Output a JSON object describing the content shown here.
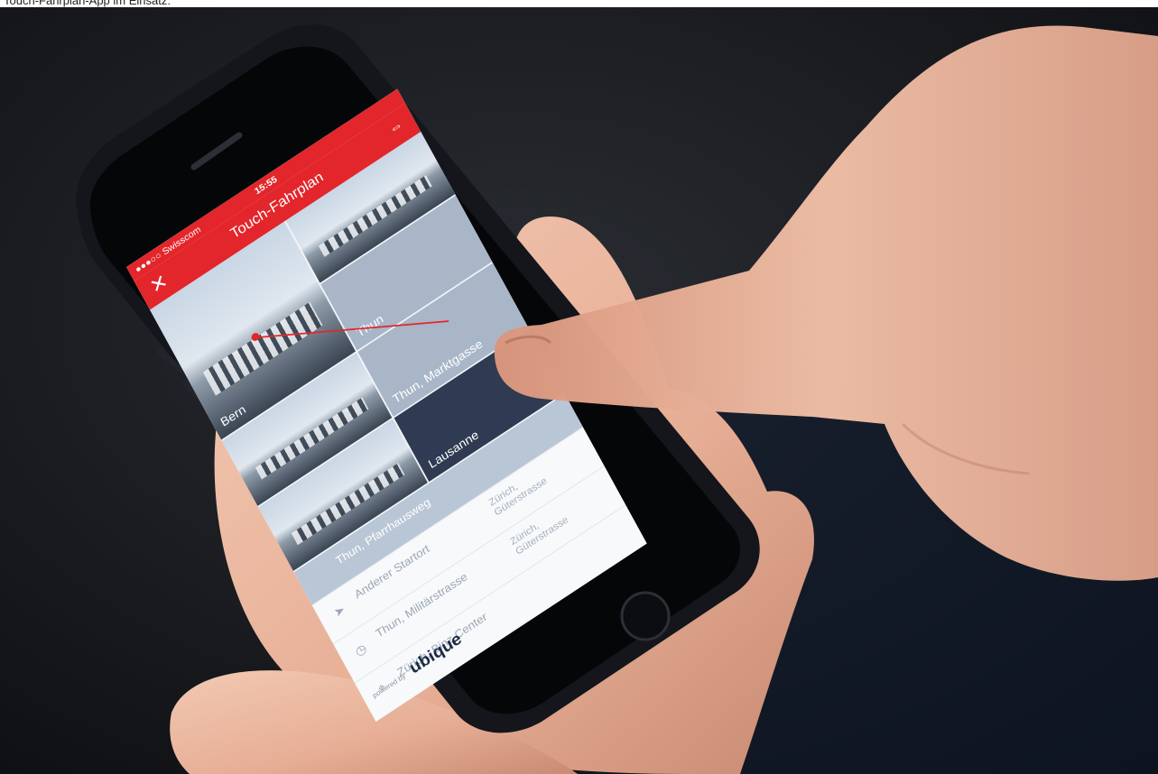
{
  "caption": "Touch-Fahrplan-App im Einsatz:",
  "app": {
    "carrier": "●●●○○ Swisscom",
    "time": "15:55",
    "title": "Touch-Fahrplan",
    "close_icon": "close-icon",
    "logo_icon": "sbb-logo-icon"
  },
  "tiles": [
    {
      "label": "Bern"
    },
    {
      "label": "Thun"
    },
    {
      "label": "Thun, Marktgasse"
    },
    {
      "label": "Lausanne"
    },
    {
      "label": "Thun, Pfarrhausweg"
    }
  ],
  "rows": [
    {
      "label": "Anderer Startort",
      "icon": "location-arrow-icon",
      "dest": "Zürich, Güterstrasse"
    },
    {
      "label": "Thun, Militärstrasse",
      "icon": "clock-icon",
      "dest": "Zürich, Güterstrasse"
    },
    {
      "label": "Zürich, Binz Center",
      "icon": "pin-icon",
      "dest": ""
    }
  ],
  "footer": {
    "powered": "powered by",
    "brand": "ubique"
  },
  "colors": {
    "sbb_red": "#e3262b",
    "tile_dark": "#2e3b52",
    "tile_grey": "#a8b6c8"
  }
}
